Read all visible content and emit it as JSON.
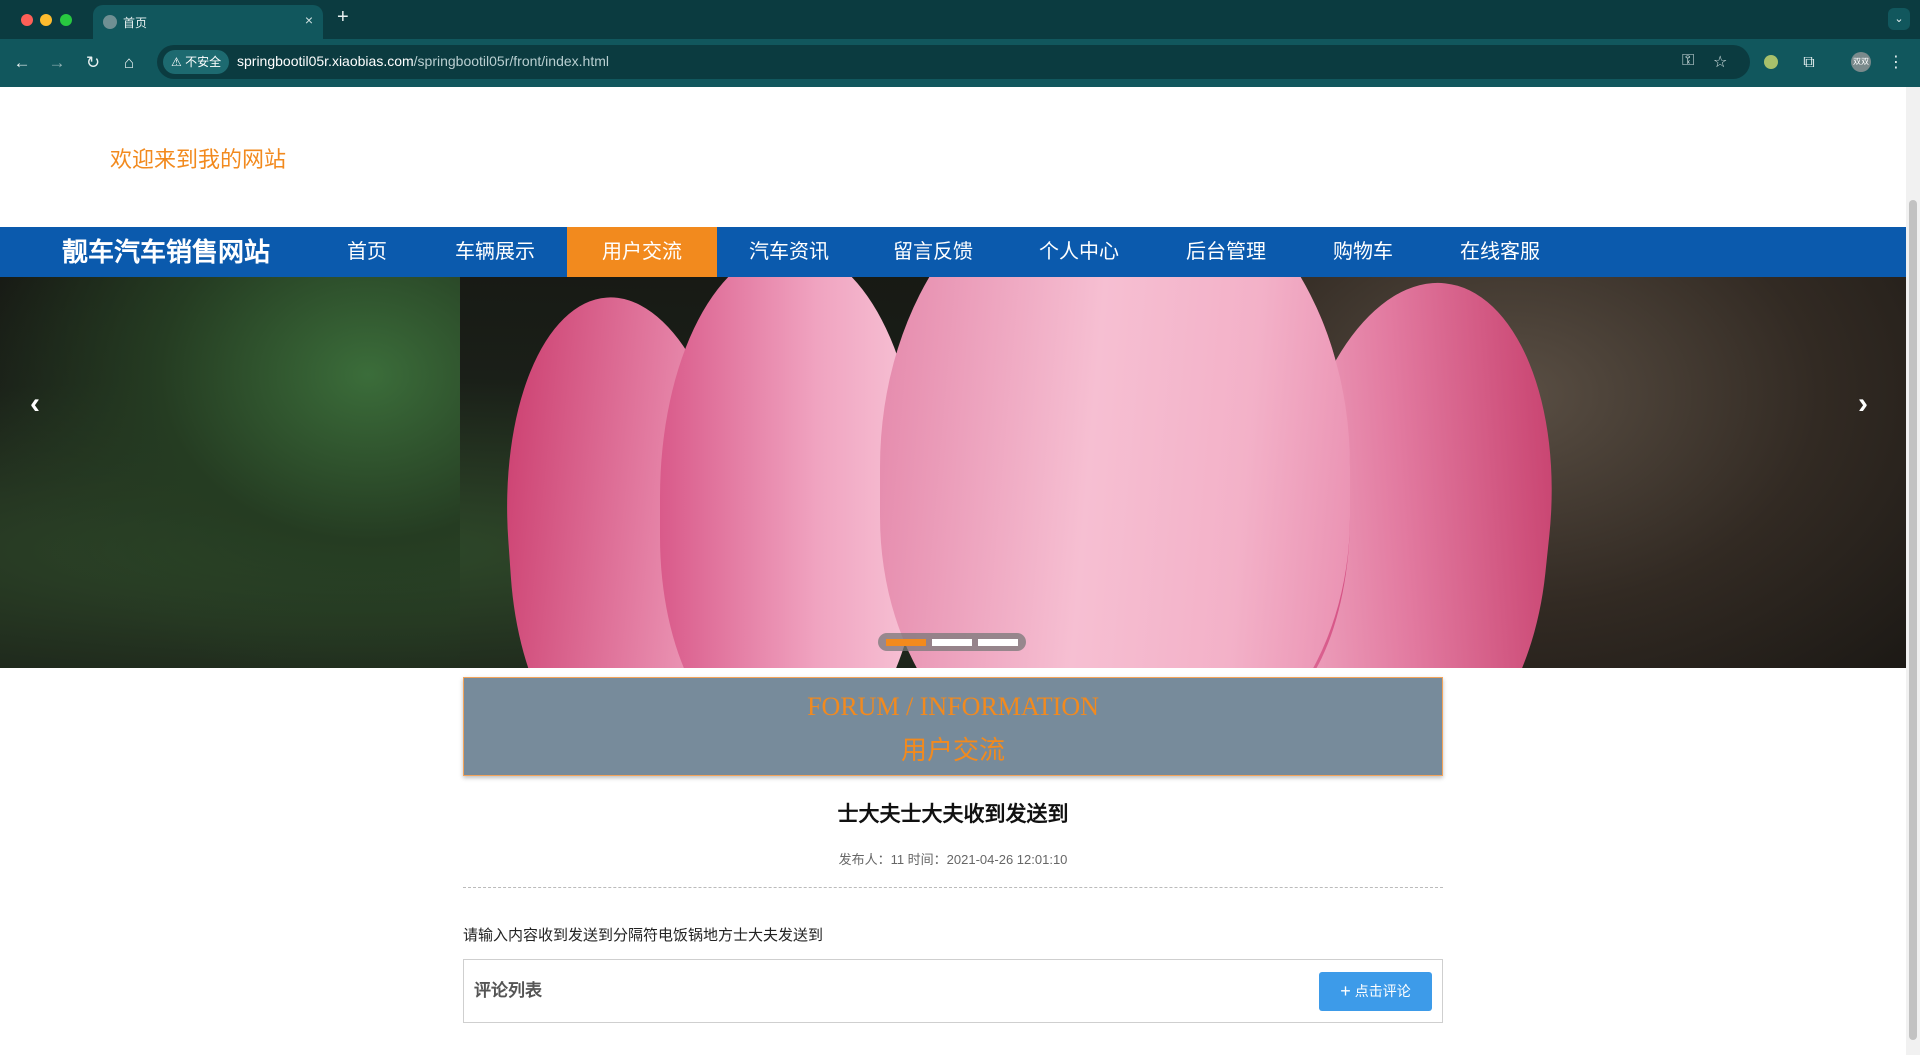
{
  "browser": {
    "tab_title": "首页",
    "tab_close": "×",
    "new_tab": "+",
    "security_label": "不安全",
    "url_host": "springbootil05r.xiaobias.com",
    "url_path": "/springbootil05r/front/index.html",
    "profile_initials": "双双"
  },
  "header": {
    "welcome_text": "欢迎来到我的网站"
  },
  "navbar": {
    "site_name": "靓车汽车销售网站",
    "items": [
      {
        "label": "首页"
      },
      {
        "label": "车辆展示"
      },
      {
        "label": "用户交流"
      },
      {
        "label": "汽车资讯"
      },
      {
        "label": "留言反馈"
      },
      {
        "label": "个人中心"
      },
      {
        "label": "后台管理"
      },
      {
        "label": "购物车"
      },
      {
        "label": "在线客服"
      }
    ],
    "active_item": "用户交流",
    "accent_color": "#f28a1e",
    "bar_color": "#0b5aad"
  },
  "carousel": {
    "prev_icon": "chevron-left-icon",
    "next_icon": "chevron-right-icon",
    "slide_count": 3,
    "active_slide": 1
  },
  "forum_banner": {
    "title_en": "FORUM / INFORMATION",
    "title_cn": "用户交流"
  },
  "post": {
    "title": "士大夫士大夫收到发送到",
    "meta": "发布人：11 时间：2021-04-26 12:01:10",
    "content": "请输入内容收到发送到分隔符电饭锅地方士大夫发送到"
  },
  "comments": {
    "title": "评论列表",
    "button_label": "点击评论",
    "button_icon": "plus-icon"
  }
}
